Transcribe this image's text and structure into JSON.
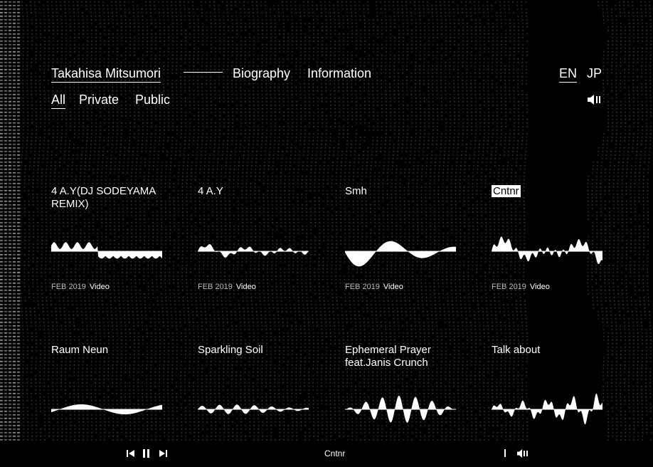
{
  "header": {
    "site_title": "Takahisa Mitsumori",
    "nav": [
      "Biography",
      "Information"
    ],
    "lang": [
      "EN",
      "JP"
    ],
    "filters": [
      "All",
      "Private",
      "Public"
    ],
    "volume_icon": "speaker-icon"
  },
  "tracks": [
    {
      "title": "4 A.Y(DJ SODEYAMA REMIX)",
      "date": "FEB 2019",
      "type": "Video"
    },
    {
      "title": "4 A.Y",
      "date": "FEB 2019",
      "type": "Video"
    },
    {
      "title": "Smh",
      "date": "FEB 2019",
      "type": "Video"
    },
    {
      "title": "Cntnr",
      "date": "FEB 2019",
      "type": "Video"
    },
    {
      "title": "Raum Neun"
    },
    {
      "title": "Sparkling Soil"
    },
    {
      "title": "Ephemeral Prayer feat.Janis Crunch"
    },
    {
      "title": "Talk about"
    }
  ],
  "player": {
    "now_playing": "Cntnr",
    "prev_icon": "skip-previous-icon",
    "pause_icon": "pause-icon",
    "next_icon": "skip-next-icon",
    "volume_icon": "speaker-icon"
  }
}
